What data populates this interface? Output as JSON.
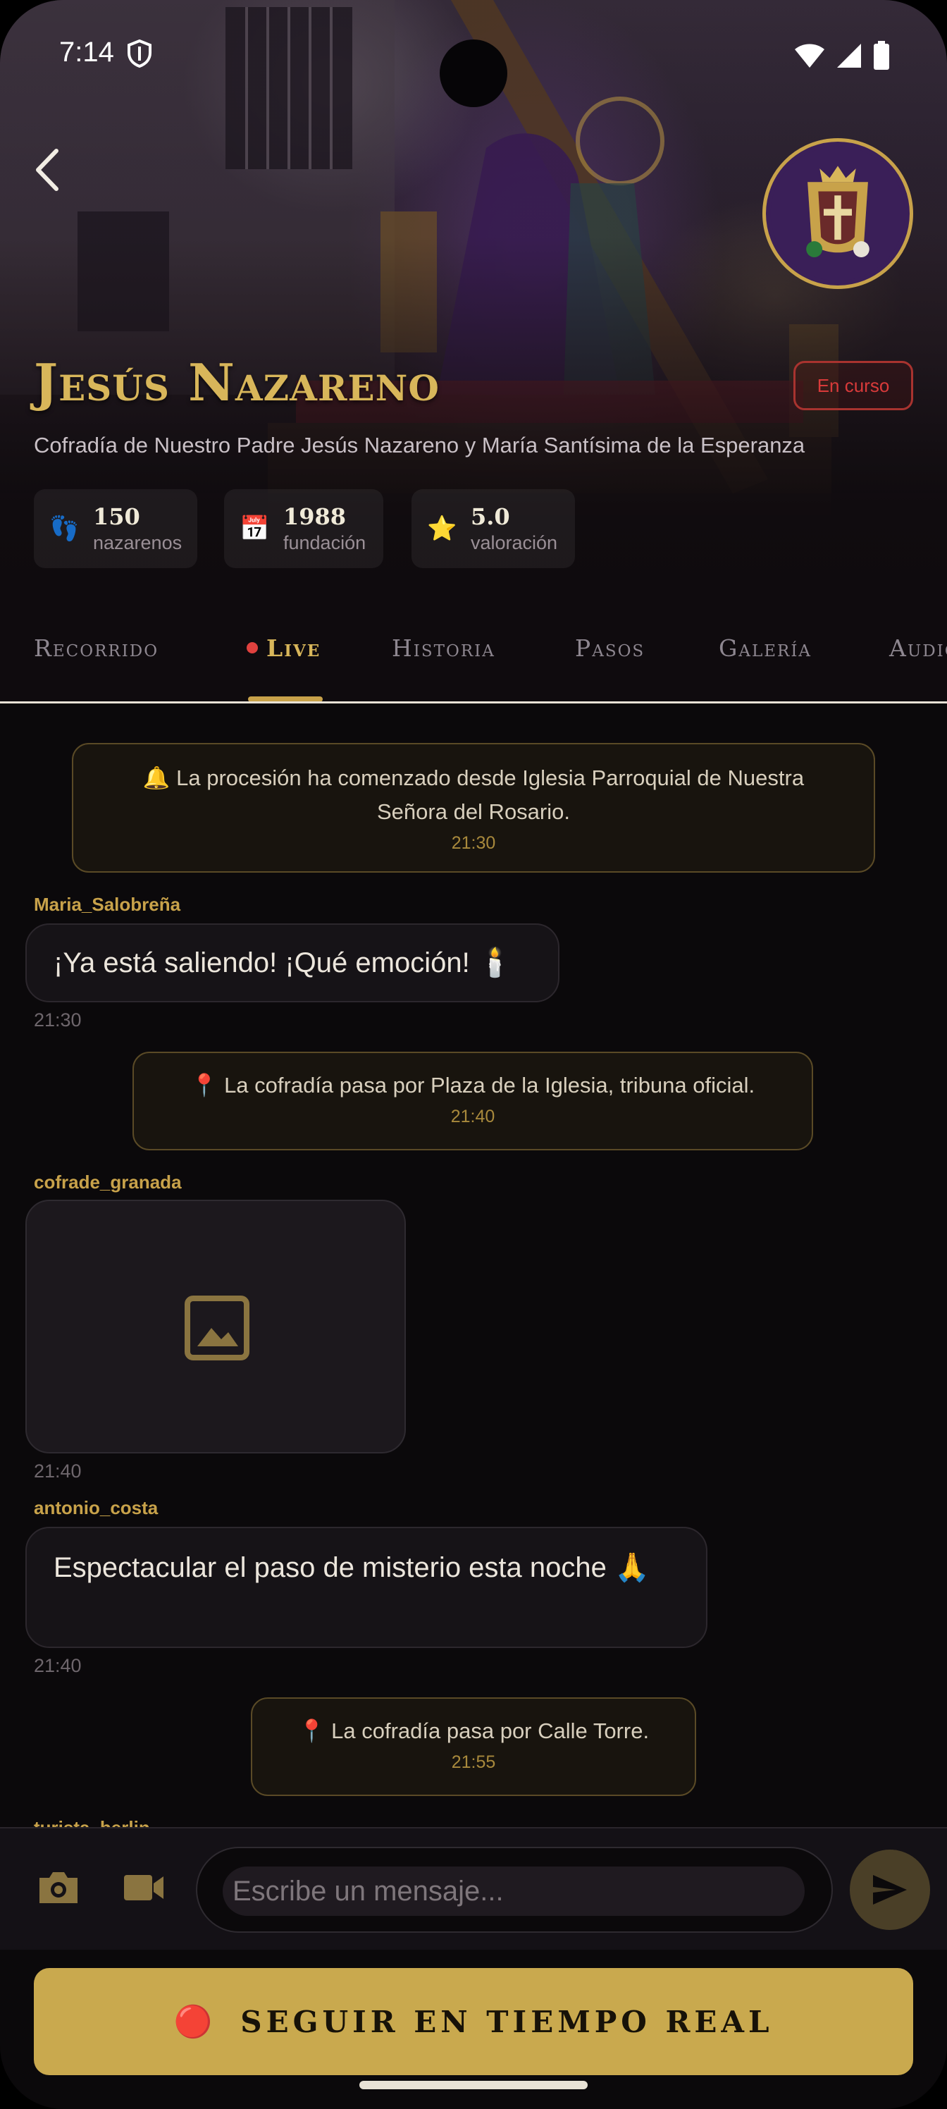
{
  "status_bar": {
    "time": "7:14",
    "icons": [
      "shield-icon",
      "wifi-icon",
      "signal-icon",
      "battery-icon"
    ]
  },
  "header": {
    "title": "Jesús Nazareno",
    "status_badge": "En curso",
    "subtitle": "Cofradía de Nuestro Padre Jesús Nazareno y María Santísima de la Esperanza",
    "stats": [
      {
        "icon": "👣",
        "value": "150",
        "label": "nazarenos"
      },
      {
        "icon": "📅",
        "value": "1988",
        "label": "fundación"
      },
      {
        "icon": "⭐",
        "value": "5.0",
        "label": "valoración"
      }
    ]
  },
  "tabs": [
    {
      "label": "Recorrido",
      "active": false
    },
    {
      "label": "Live",
      "active": true
    },
    {
      "label": "Historia",
      "active": false
    },
    {
      "label": "Pasos",
      "active": false
    },
    {
      "label": "Galería",
      "active": false
    },
    {
      "label": "Audio",
      "active": false
    }
  ],
  "chat": {
    "system_messages": [
      {
        "text": "🔔 La procesión ha comenzado desde Iglesia Parroquial de Nuestra Señora del Rosario.",
        "time": "21:30"
      },
      {
        "text": "📍 La cofradía pasa por Plaza de la Iglesia, tribuna oficial.",
        "time": "21:40"
      },
      {
        "text": "📍 La cofradía pasa por Calle Torre.",
        "time": "21:55"
      }
    ],
    "messages": [
      {
        "user": "Maria_Salobreña",
        "text": "¡Ya está saliendo! ¡Qué emoción! 🕯️",
        "time": "21:30"
      },
      {
        "user": "cofrade_granada",
        "text": "",
        "time": "21:40",
        "image": true
      },
      {
        "user": "antonio_costa",
        "text": "Espectacular el paso de misterio esta noche 🙏",
        "time": "21:40"
      },
      {
        "user": "turista_berlin"
      }
    ]
  },
  "input": {
    "placeholder": "Escribe un mensaje..."
  },
  "follow_button": {
    "icon": "🔴",
    "label": "SEGUIR EN TIEMPO REAL"
  },
  "colors": {
    "accent": "#c9a94e",
    "live": "#e0413e",
    "background": "#0b090b"
  }
}
